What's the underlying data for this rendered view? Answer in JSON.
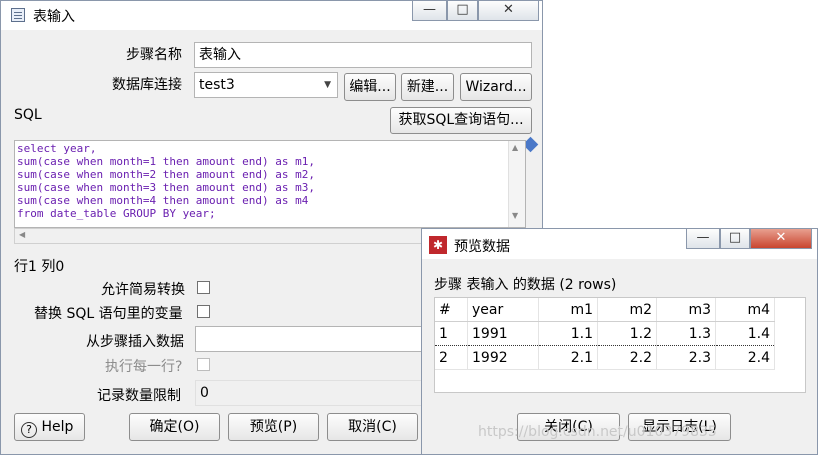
{
  "main_window": {
    "title": "表输入",
    "buttons": {
      "minimize": "—",
      "maximize": "□",
      "close": "✕"
    },
    "step_name_label": "步骤名称",
    "step_name_value": "表输入",
    "db_conn_label": "数据库连接",
    "db_conn_value": "test3",
    "edit_label": "编辑...",
    "new_label": "新建...",
    "wizard_label": "Wizard...",
    "sql_label": "SQL",
    "get_sql_label": "获取SQL查询语句...",
    "sql_lines": [
      "select year,",
      "sum(case when month=1 then amount end) as m1,",
      "sum(case when month=2 then amount end) as m2,",
      "sum(case when month=3 then amount end) as m3,",
      "sum(case when month=4 then amount end) as m4",
      "from date_table GROUP BY year;"
    ],
    "cursor_pos": "行1 列0",
    "allow_lazy_conversion": "允许简易转换",
    "replace_vars": "替换 SQL 语句里的变量",
    "insert_from_step": "从步骤插入数据",
    "execute_each_row": "执行每一行?",
    "limit_label": "记录数量限制",
    "limit_value": "0",
    "help_label": "Help",
    "ok_label": "确定(O)",
    "preview_label": "预览(P)",
    "cancel_label": "取消(C)"
  },
  "preview_window": {
    "title": "预览数据",
    "buttons": {
      "minimize": "—",
      "maximize": "□",
      "close": "✕"
    },
    "caption": "步骤 表输入 的数据 (2 rows)",
    "columns": [
      "#",
      "year",
      "m1",
      "m2",
      "m3",
      "m4"
    ],
    "rows": [
      [
        "1",
        "1991",
        "1.1",
        "1.2",
        "1.3",
        "1.4"
      ],
      [
        "2",
        "1992",
        "2.1",
        "2.2",
        "2.3",
        "2.4"
      ]
    ],
    "close_label": "关闭(C)",
    "show_log_label": "显示日志(L)"
  },
  "watermark": "https://blog.csdn.net/u010379835"
}
